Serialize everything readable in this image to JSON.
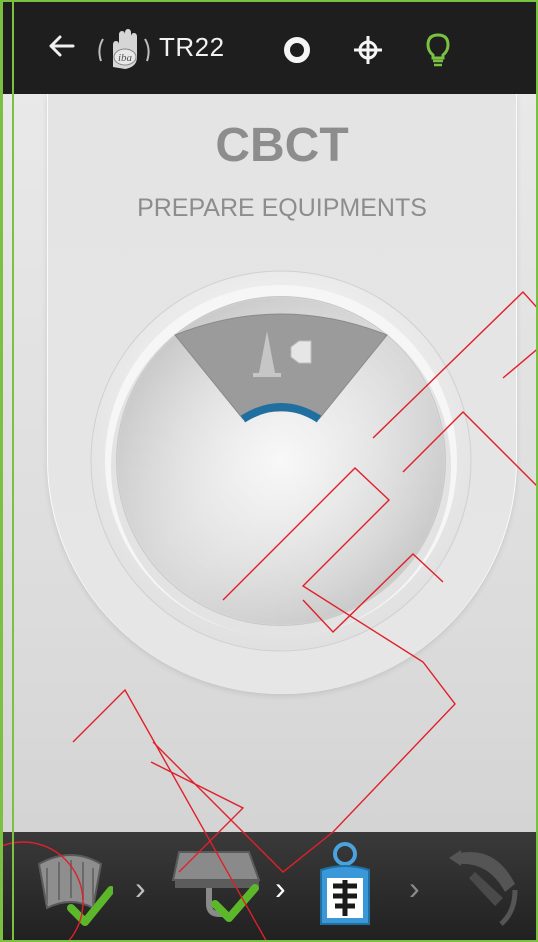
{
  "header": {
    "title": "TR22",
    "logo_text": "iba",
    "icons": [
      "back-arrow-icon",
      "iba-hand-logo",
      "ring-icon",
      "crosshair-icon",
      "light-bulb-icon"
    ],
    "bulb_color": "#7ac142"
  },
  "main": {
    "mode": "CBCT",
    "step": "PREPARE EQUIPMENTS",
    "accent_color": "#1f6fa0"
  },
  "workflow": {
    "steps": [
      {
        "name": "gantry-detector",
        "status": "done"
      },
      {
        "name": "couch",
        "status": "done"
      },
      {
        "name": "patient-imaging",
        "status": "active"
      },
      {
        "name": "gantry-rotation",
        "status": "pending"
      }
    ],
    "check_color": "#5cb82a"
  }
}
